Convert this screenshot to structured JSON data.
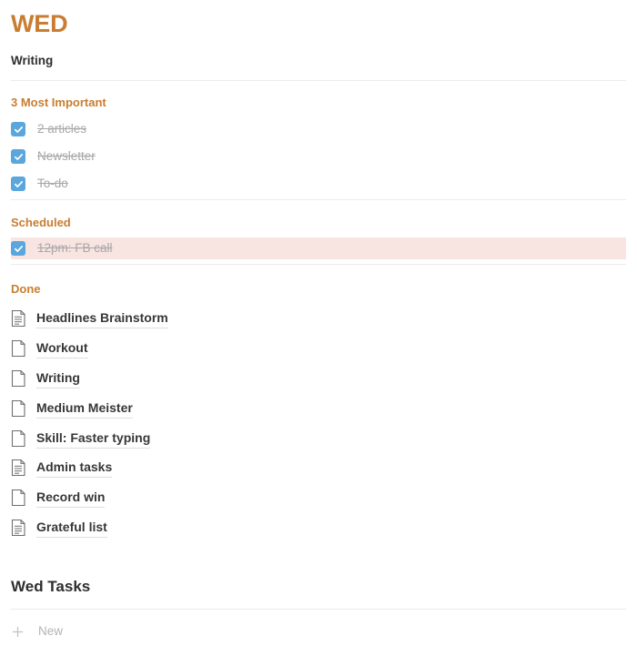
{
  "header": {
    "day": "WED",
    "subtitle": "Writing",
    "accent_color": "#c87d30"
  },
  "sections": [
    {
      "heading": "3 Most Important",
      "type": "checklist",
      "items": [
        {
          "label": "2 articles",
          "checked": true,
          "highlighted": false
        },
        {
          "label": "Newsletter",
          "checked": true,
          "highlighted": false
        },
        {
          "label": "To-do",
          "checked": true,
          "highlighted": false
        }
      ]
    },
    {
      "heading": "Scheduled",
      "type": "checklist",
      "items": [
        {
          "label": "12pm: FB call",
          "checked": true,
          "highlighted": true
        }
      ]
    },
    {
      "heading": "Done",
      "type": "documents",
      "items": [
        {
          "label": "Headlines Brainstorm",
          "icon": "document-lined-icon"
        },
        {
          "label": "Workout",
          "icon": "document-blank-icon"
        },
        {
          "label": "Writing",
          "icon": "document-blank-icon"
        },
        {
          "label": "Medium Meister",
          "icon": "document-blank-icon"
        },
        {
          "label": "Skill: Faster typing",
          "icon": "document-blank-icon"
        },
        {
          "label": "Admin tasks",
          "icon": "document-lined-icon"
        },
        {
          "label": "Record win",
          "icon": "document-blank-icon"
        },
        {
          "label": "Grateful list",
          "icon": "document-lined-icon"
        }
      ]
    }
  ],
  "tasks_block": {
    "title": "Wed Tasks",
    "new_label": "New",
    "new_icon": "plus-icon"
  },
  "colors": {
    "accent": "#c87d30",
    "checkbox": "#5ba7dd",
    "highlight_row": "#f8e4e0",
    "divider": "#ebebeb",
    "muted_text": "#a7a7a7"
  }
}
